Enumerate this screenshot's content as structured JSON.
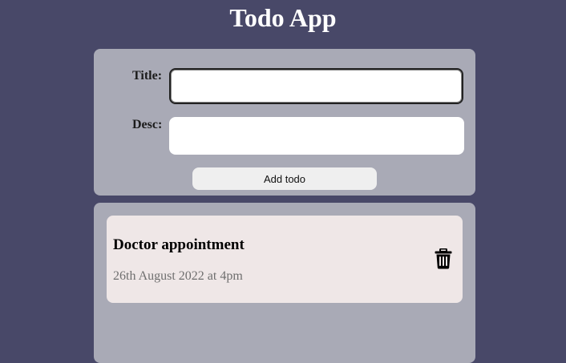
{
  "app": {
    "title": "Todo App"
  },
  "form": {
    "title_label": "Title:",
    "title_value": "",
    "desc_label": "Desc:",
    "desc_value": "",
    "add_button_label": "Add todo"
  },
  "todos": [
    {
      "title": "Doctor appointment",
      "date": "26th August 2022 at 4pm",
      "delete_icon": "trash-icon"
    }
  ],
  "colors": {
    "background": "#484868",
    "panel": "#a9aab6",
    "card": "#efe7e7",
    "button": "#efefef",
    "date_text": "#6e6e6e"
  }
}
